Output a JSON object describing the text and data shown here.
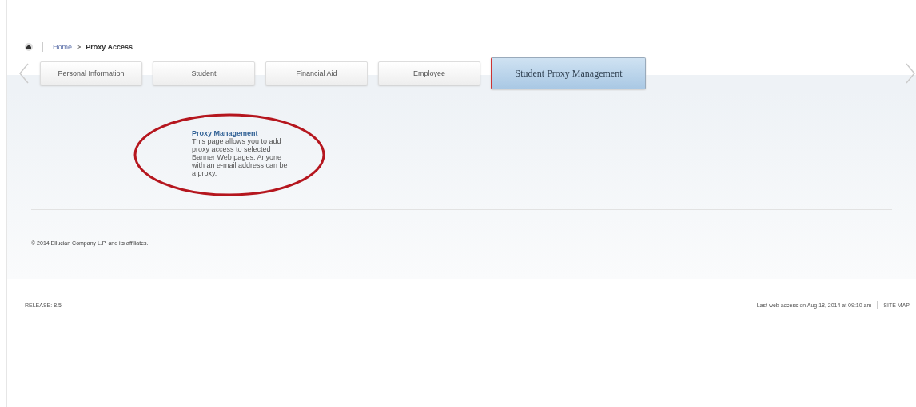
{
  "breadcrumb": {
    "items": [
      {
        "label": "Home",
        "kind": "link"
      },
      {
        "label": "Proxy Access",
        "kind": "current"
      }
    ],
    "separator": ">"
  },
  "tabs": [
    {
      "label": "Personal Information",
      "selected": false
    },
    {
      "label": "Student",
      "selected": false
    },
    {
      "label": "Financial Aid",
      "selected": false
    },
    {
      "label": "Employee",
      "selected": false
    },
    {
      "label": "Student Proxy Management",
      "selected": true
    }
  ],
  "menu_item": {
    "title": "Proxy Management",
    "description": "This page allows you to add proxy access to selected Banner Web pages. Anyone with an e-mail address can be a proxy.",
    "circled": true
  },
  "copyright": "© 2014 Ellucian Company L.P. and its affiliates.",
  "status_bar": {
    "release": "RELEASE: 8.5",
    "last_access": "Last web access on Aug 18, 2014 at 09:10 am",
    "site_map": "SITE MAP"
  }
}
